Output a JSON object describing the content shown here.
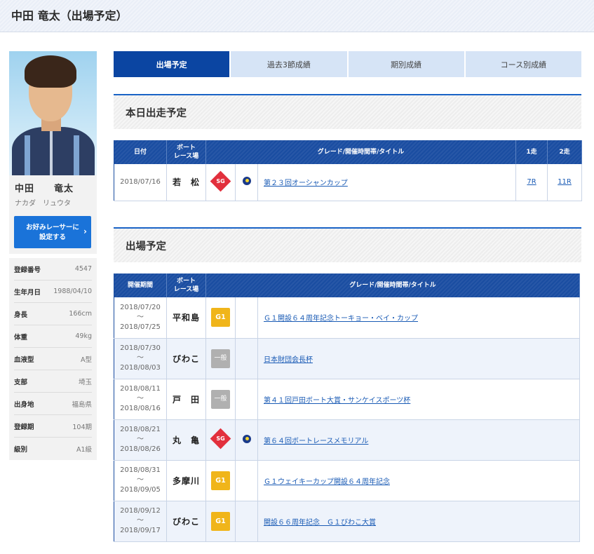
{
  "page": {
    "title": "中田 竜太（出場予定）"
  },
  "profile": {
    "name_kanji": "中田　　竜太",
    "name_kana": "ナカダ　リュウタ",
    "fav_button": [
      "お好みレーサーに",
      "設定する"
    ],
    "fav_chevron": "›",
    "info": [
      {
        "label": "登録番号",
        "value": "4547"
      },
      {
        "label": "生年月日",
        "value": "1988/04/10"
      },
      {
        "label": "身長",
        "value": "166cm"
      },
      {
        "label": "体重",
        "value": "49kg"
      },
      {
        "label": "血液型",
        "value": "A型"
      },
      {
        "label": "支部",
        "value": "埼玉"
      },
      {
        "label": "出身地",
        "value": "福島県"
      },
      {
        "label": "登録期",
        "value": "104期"
      },
      {
        "label": "級別",
        "value": "A1級"
      }
    ]
  },
  "tabs": [
    {
      "label": "出場予定",
      "active": true
    },
    {
      "label": "過去3節成績",
      "active": false
    },
    {
      "label": "期別成績",
      "active": false
    },
    {
      "label": "コース別成績",
      "active": false
    }
  ],
  "today": {
    "heading": "本日出走予定",
    "headers": {
      "date": "日付",
      "venue1": "ボート",
      "venue2": "レース場",
      "title": "グレード/開催時間帯/タイトル",
      "r1": "1走",
      "r2": "2走"
    },
    "rows": [
      {
        "date": "2018/07/16",
        "venue": "若　松",
        "grade": "SG",
        "time_icon": "nighter-moon-icon",
        "title": "第２３回オーシャンカップ",
        "race1": "7R",
        "race2": "11R"
      }
    ]
  },
  "schedule": {
    "heading": "出場予定",
    "headers": {
      "period": "開催期間",
      "venue1": "ボート",
      "venue2": "レース場",
      "title": "グレード/開催時間帯/タイトル"
    },
    "rows": [
      {
        "start": "2018/07/20",
        "sep": "～",
        "end": "2018/07/25",
        "venue": "平和島",
        "grade": "G1",
        "grade_type": "g1",
        "night": false,
        "title": "Ｇ１開設６４周年記念トーキョー・ベイ・カップ"
      },
      {
        "start": "2018/07/30",
        "sep": "～",
        "end": "2018/08/03",
        "venue": "びわこ",
        "grade": "一般",
        "grade_type": "ippan",
        "night": false,
        "title": "日本財団会長杯"
      },
      {
        "start": "2018/08/11",
        "sep": "～",
        "end": "2018/08/16",
        "venue": "戸　田",
        "grade": "一般",
        "grade_type": "ippan",
        "night": false,
        "title": "第４１回戸田ボート大賞・サンケイスポーツ杯"
      },
      {
        "start": "2018/08/21",
        "sep": "～",
        "end": "2018/08/26",
        "venue": "丸　亀",
        "grade": "SG",
        "grade_type": "sg",
        "night": true,
        "title": "第６４回ボートレースメモリアル"
      },
      {
        "start": "2018/08/31",
        "sep": "～",
        "end": "2018/09/05",
        "venue": "多摩川",
        "grade": "G1",
        "grade_type": "g1",
        "night": false,
        "title": "Ｇ１ウェイキーカップ開設６４周年記念"
      },
      {
        "start": "2018/09/12",
        "sep": "～",
        "end": "2018/09/17",
        "venue": "びわこ",
        "grade": "G1",
        "grade_type": "g1",
        "night": false,
        "title": "開設６６周年記念　Ｇ１びわこ大賞"
      }
    ]
  }
}
